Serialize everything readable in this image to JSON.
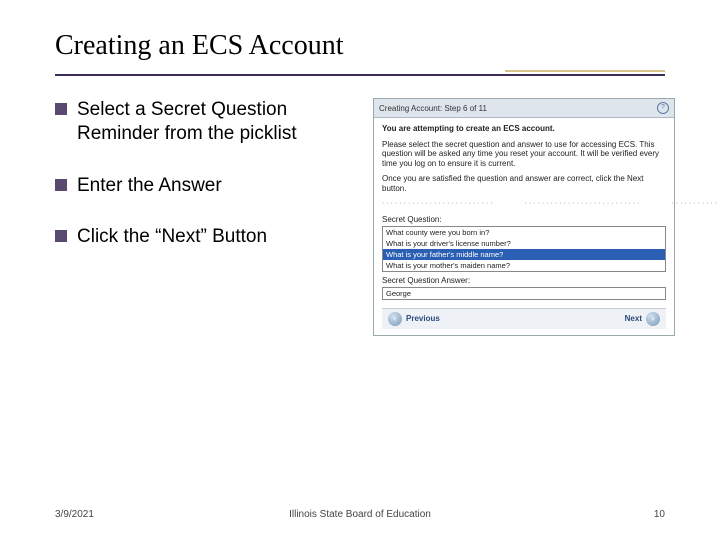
{
  "title": "Creating an ECS Account",
  "bullets": [
    "Select a Secret Question Reminder from the picklist",
    "Enter the Answer",
    "Click the “Next” Button"
  ],
  "shot": {
    "bar_title": "Creating Account: Step 6 of 11",
    "intro_bold": "You are attempting to create an ECS account.",
    "para1": "Please select the secret question and answer to use for accessing ECS. This question will be asked any time you reset your account. It will be verified every time you log on to ensure it is current.",
    "para2": "Once you are satisfied the question and answer are correct, click the Next button.",
    "sq_label": "Secret Question:",
    "options": [
      "What county were you born in?",
      "What is your driver's license number?",
      "What is your father's middle name?",
      "What is your mother's maiden name?"
    ],
    "selected_index": 2,
    "ans_label": "Secret Question Answer:",
    "answer_value": "George",
    "prev": "Previous",
    "next": "Next"
  },
  "footer": {
    "date": "3/9/2021",
    "org": "Illinois State Board of Education",
    "page": "10"
  }
}
